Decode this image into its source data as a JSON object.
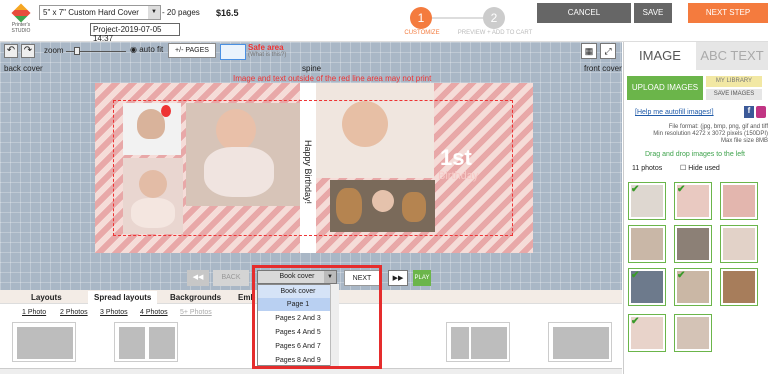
{
  "header": {
    "logo_text": "Printer's STUDIO",
    "size_select": "5\" x 7\" Custom Hard Cover",
    "pages_text": "- 20 pages",
    "price": "$16.5",
    "project_name": "Project-2019-07-05 14:37",
    "step1_num": "1",
    "step1_label": "CUSTOMIZE",
    "step2_num": "2",
    "step2_label": "PREVIEW + ADD TO CART",
    "cancel": "CANCEL",
    "save": "SAVE",
    "next_step": "NEXT STEP"
  },
  "toolbar": {
    "undo": "↶",
    "redo": "↷",
    "zoom": "zoom",
    "autofit": "auto fit",
    "pages_btn": "+/- PAGES",
    "safe_area": "Safe area",
    "safe_sub": "(What is this?)"
  },
  "canvas": {
    "back_cover": "back cover",
    "spine": "spine",
    "front_cover": "front cover",
    "warning": "Image and text outside of the red line area may not print",
    "spine_text": "Happy Birthday!",
    "first": "1st",
    "birthday": "Birthday"
  },
  "nav": {
    "back": "BACK",
    "selected": "Book cover",
    "next": "NEXT",
    "play": "PLAY"
  },
  "dropdown": {
    "items": [
      "Book cover",
      "Page 1",
      "Pages 2 And 3",
      "Pages 4 And 5",
      "Pages 6 And 7",
      "Pages 8 And 9"
    ]
  },
  "bottom_tabs": [
    "Layouts",
    "Spread layouts",
    "Backgrounds",
    "Emb"
  ],
  "photo_filters": [
    "1 Photo",
    "2 Photos",
    "3 Photos",
    "4 Photos",
    "5+ Photos"
  ],
  "right_panel": {
    "tab_image": "IMAGE",
    "tab_text": "ABC TEXT",
    "upload": "UPLOAD IMAGES",
    "my_library": "MY LIBRARY",
    "save_images": "SAVE IMAGES",
    "help": "[Help me autofill images!]",
    "file_info_1": "File format: (jpg, bmp, png, gif and tiff",
    "file_info_2": "Min resolution 4272 x 3072 pixels (150DPI)",
    "file_info_3": "Max file size 8MB",
    "drag": "Drag and drop images to the left",
    "count": "11 photos",
    "hide_used": "Hide used"
  },
  "colors": {
    "accent": "#f47b3e",
    "green": "#6bb54a",
    "canvas_bg": "#a9b7c6",
    "highlight": "#e52d2d"
  }
}
